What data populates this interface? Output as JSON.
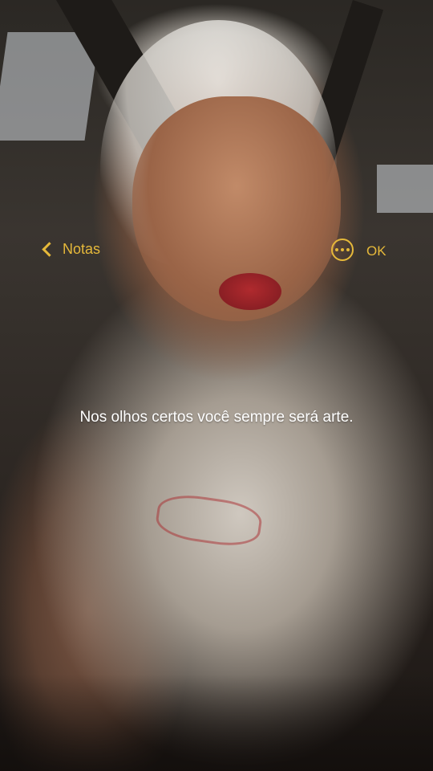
{
  "nav": {
    "back_label": "Notas",
    "done_label": "OK",
    "back_icon": "chevron-left-icon",
    "more_icon": "ellipsis-circle-icon"
  },
  "note": {
    "text": "Nos olhos certos você sempre será arte."
  },
  "colors": {
    "accent": "#e6b93a",
    "text": "#ffffff"
  }
}
